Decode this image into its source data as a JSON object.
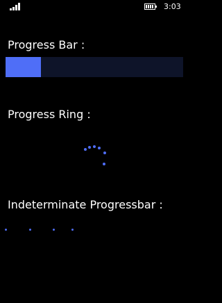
{
  "status_bar": {
    "time": "3:03",
    "signal_icon": "signal-bars-icon",
    "battery_icon": "battery-icon"
  },
  "progress_bar": {
    "label": "Progress Bar :",
    "value_fraction": 0.2,
    "track_color": "#0e1429",
    "fill_color": "#4f6ef7"
  },
  "progress_ring": {
    "label": "Progress Ring :",
    "dot_color": "#4f6ef7"
  },
  "indeterminate_bar": {
    "label": "Indeterminate Progressbar :",
    "dot_color": "#4f6ef7"
  }
}
